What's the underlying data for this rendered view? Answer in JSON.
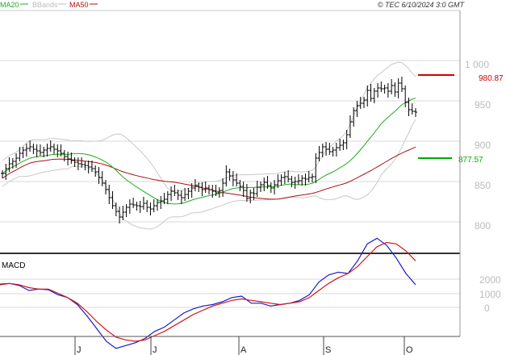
{
  "header": {
    "legend": [
      {
        "name": "MA20",
        "color": "#22aa22"
      },
      {
        "name": "BBands",
        "color": "#bbbbbb"
      },
      {
        "name": "MA50",
        "color": "#aa1111"
      }
    ],
    "copyright": "© TEC 6/10/2024 3:0 GMT"
  },
  "chart_data": [
    {
      "type": "ohlc",
      "indicators": [
        "MA20",
        "BBands",
        "MA50"
      ],
      "ylim": [
        780,
        1020
      ],
      "y_ticks": [
        "1 000",
        "950",
        "900",
        "850",
        "800"
      ],
      "x_ticks": [
        "J",
        "J",
        "A",
        "S",
        "O"
      ],
      "grid": true,
      "legend_position": "top-left",
      "levels": [
        {
          "value": 980.87,
          "label": "980.87",
          "color": "#cc0000"
        },
        {
          "value": 877.57,
          "label": "877.57",
          "color": "#00aa00"
        }
      ],
      "closes": [
        860,
        866,
        872,
        875,
        879,
        885,
        889,
        891,
        893,
        890,
        888,
        886,
        889,
        891,
        893,
        890,
        888,
        885,
        881,
        878,
        876,
        874,
        872,
        871,
        870,
        868,
        866,
        862,
        855,
        848,
        840,
        830,
        820,
        813,
        806,
        812,
        818,
        822,
        821,
        820,
        819,
        823,
        818,
        816,
        820,
        824,
        826,
        828,
        834,
        838,
        836,
        833,
        830,
        834,
        838,
        842,
        845,
        843,
        840,
        842,
        840,
        838,
        836,
        839,
        848,
        862,
        857,
        852,
        848,
        844,
        839,
        829,
        836,
        835,
        843,
        846,
        849,
        845,
        842,
        846,
        851,
        855,
        856,
        853,
        849,
        850,
        851,
        854,
        853,
        855,
        856,
        879,
        886,
        893,
        890,
        887,
        889,
        892,
        895,
        898,
        908,
        924,
        938,
        944,
        947,
        951,
        963,
        953,
        962,
        966,
        965,
        966,
        962,
        969,
        961,
        972,
        965,
        948,
        939,
        937,
        936
      ]
    },
    {
      "type": "line",
      "title": "MACD",
      "y_ticks": [
        "2000",
        "1000",
        "0"
      ],
      "series": [
        {
          "name": "MACD",
          "color": "#1a1acc",
          "values": [
            1650,
            1700,
            1550,
            1200,
            1300,
            1250,
            900,
            700,
            200,
            -600,
            -1500,
            -2400,
            -2900,
            -2700,
            -2500,
            -2200,
            -1700,
            -1400,
            -900,
            -400,
            -100,
            100,
            200,
            400,
            700,
            800,
            300,
            300,
            100,
            200,
            300,
            500,
            900,
            1800,
            2300,
            2500,
            2400,
            3300,
            4500,
            4900,
            4400,
            3500,
            2400,
            1600
          ]
        },
        {
          "name": "Signal",
          "color": "#cc1a1a",
          "values": [
            1600,
            1700,
            1600,
            1400,
            1300,
            1300,
            1000,
            700,
            300,
            -300,
            -1000,
            -1600,
            -2100,
            -2300,
            -2400,
            -2300,
            -2000,
            -1700,
            -1300,
            -900,
            -500,
            -200,
            100,
            300,
            500,
            600,
            500,
            400,
            300,
            200,
            300,
            400,
            700,
            1200,
            1700,
            2100,
            2400,
            2900,
            3600,
            4300,
            4600,
            4500,
            4000,
            3300
          ]
        }
      ]
    }
  ]
}
